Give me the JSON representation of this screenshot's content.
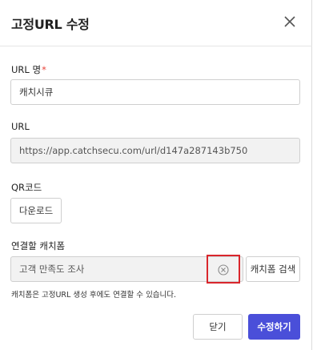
{
  "header": {
    "title": "고정URL 수정"
  },
  "url_name": {
    "label": "URL 명",
    "required_mark": "*",
    "value": "캐치시큐"
  },
  "url": {
    "label": "URL",
    "value": "https://app.catchsecu.com/url/d147a287143b750"
  },
  "qr": {
    "label": "QR코드",
    "download_label": "다운로드"
  },
  "linked_catchform": {
    "label": "연결할 캐치폼",
    "value": "고객 만족도 조사",
    "search_label": "캐치폼 검색",
    "hint": "캐치폼은 고정URL 생성 후에도 연결할 수 있습니다."
  },
  "footer": {
    "close_label": "닫기",
    "submit_label": "수정하기"
  },
  "colors": {
    "primary": "#4a4fd9",
    "required": "#e8443a",
    "highlight": "#d9262c"
  },
  "icons": {
    "close": "close-icon",
    "clear": "clear-circle-icon"
  }
}
